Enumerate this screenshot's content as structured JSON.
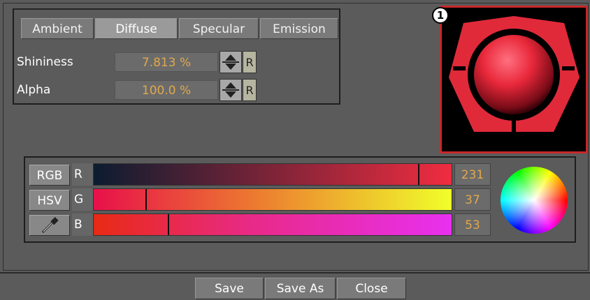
{
  "material": {
    "tabs": [
      {
        "label": "Ambient"
      },
      {
        "label": "Diffuse"
      },
      {
        "label": "Specular"
      },
      {
        "label": "Emission"
      }
    ],
    "active_tab": "Diffuse",
    "shininess": {
      "label": "Shininess",
      "value": "7.813 %",
      "reset": "R"
    },
    "alpha": {
      "label": "Alpha",
      "value": "100.0 %",
      "reset": "R"
    }
  },
  "preview": {
    "badge": "1",
    "colors": {
      "body": "#e02a3a",
      "background": "#000000",
      "border": "#c8282a"
    }
  },
  "color_picker": {
    "modes": {
      "rgb": "RGB",
      "hsv": "HSV",
      "eyedropper": "eyedropper-icon"
    },
    "channels": [
      {
        "label": "R",
        "value": "231",
        "level": 0.906
      },
      {
        "label": "G",
        "value": "37",
        "level": 0.145
      },
      {
        "label": "B",
        "value": "53",
        "level": 0.208
      }
    ]
  },
  "footer": {
    "save": "Save",
    "save_as": "Save As",
    "close": "Close"
  }
}
